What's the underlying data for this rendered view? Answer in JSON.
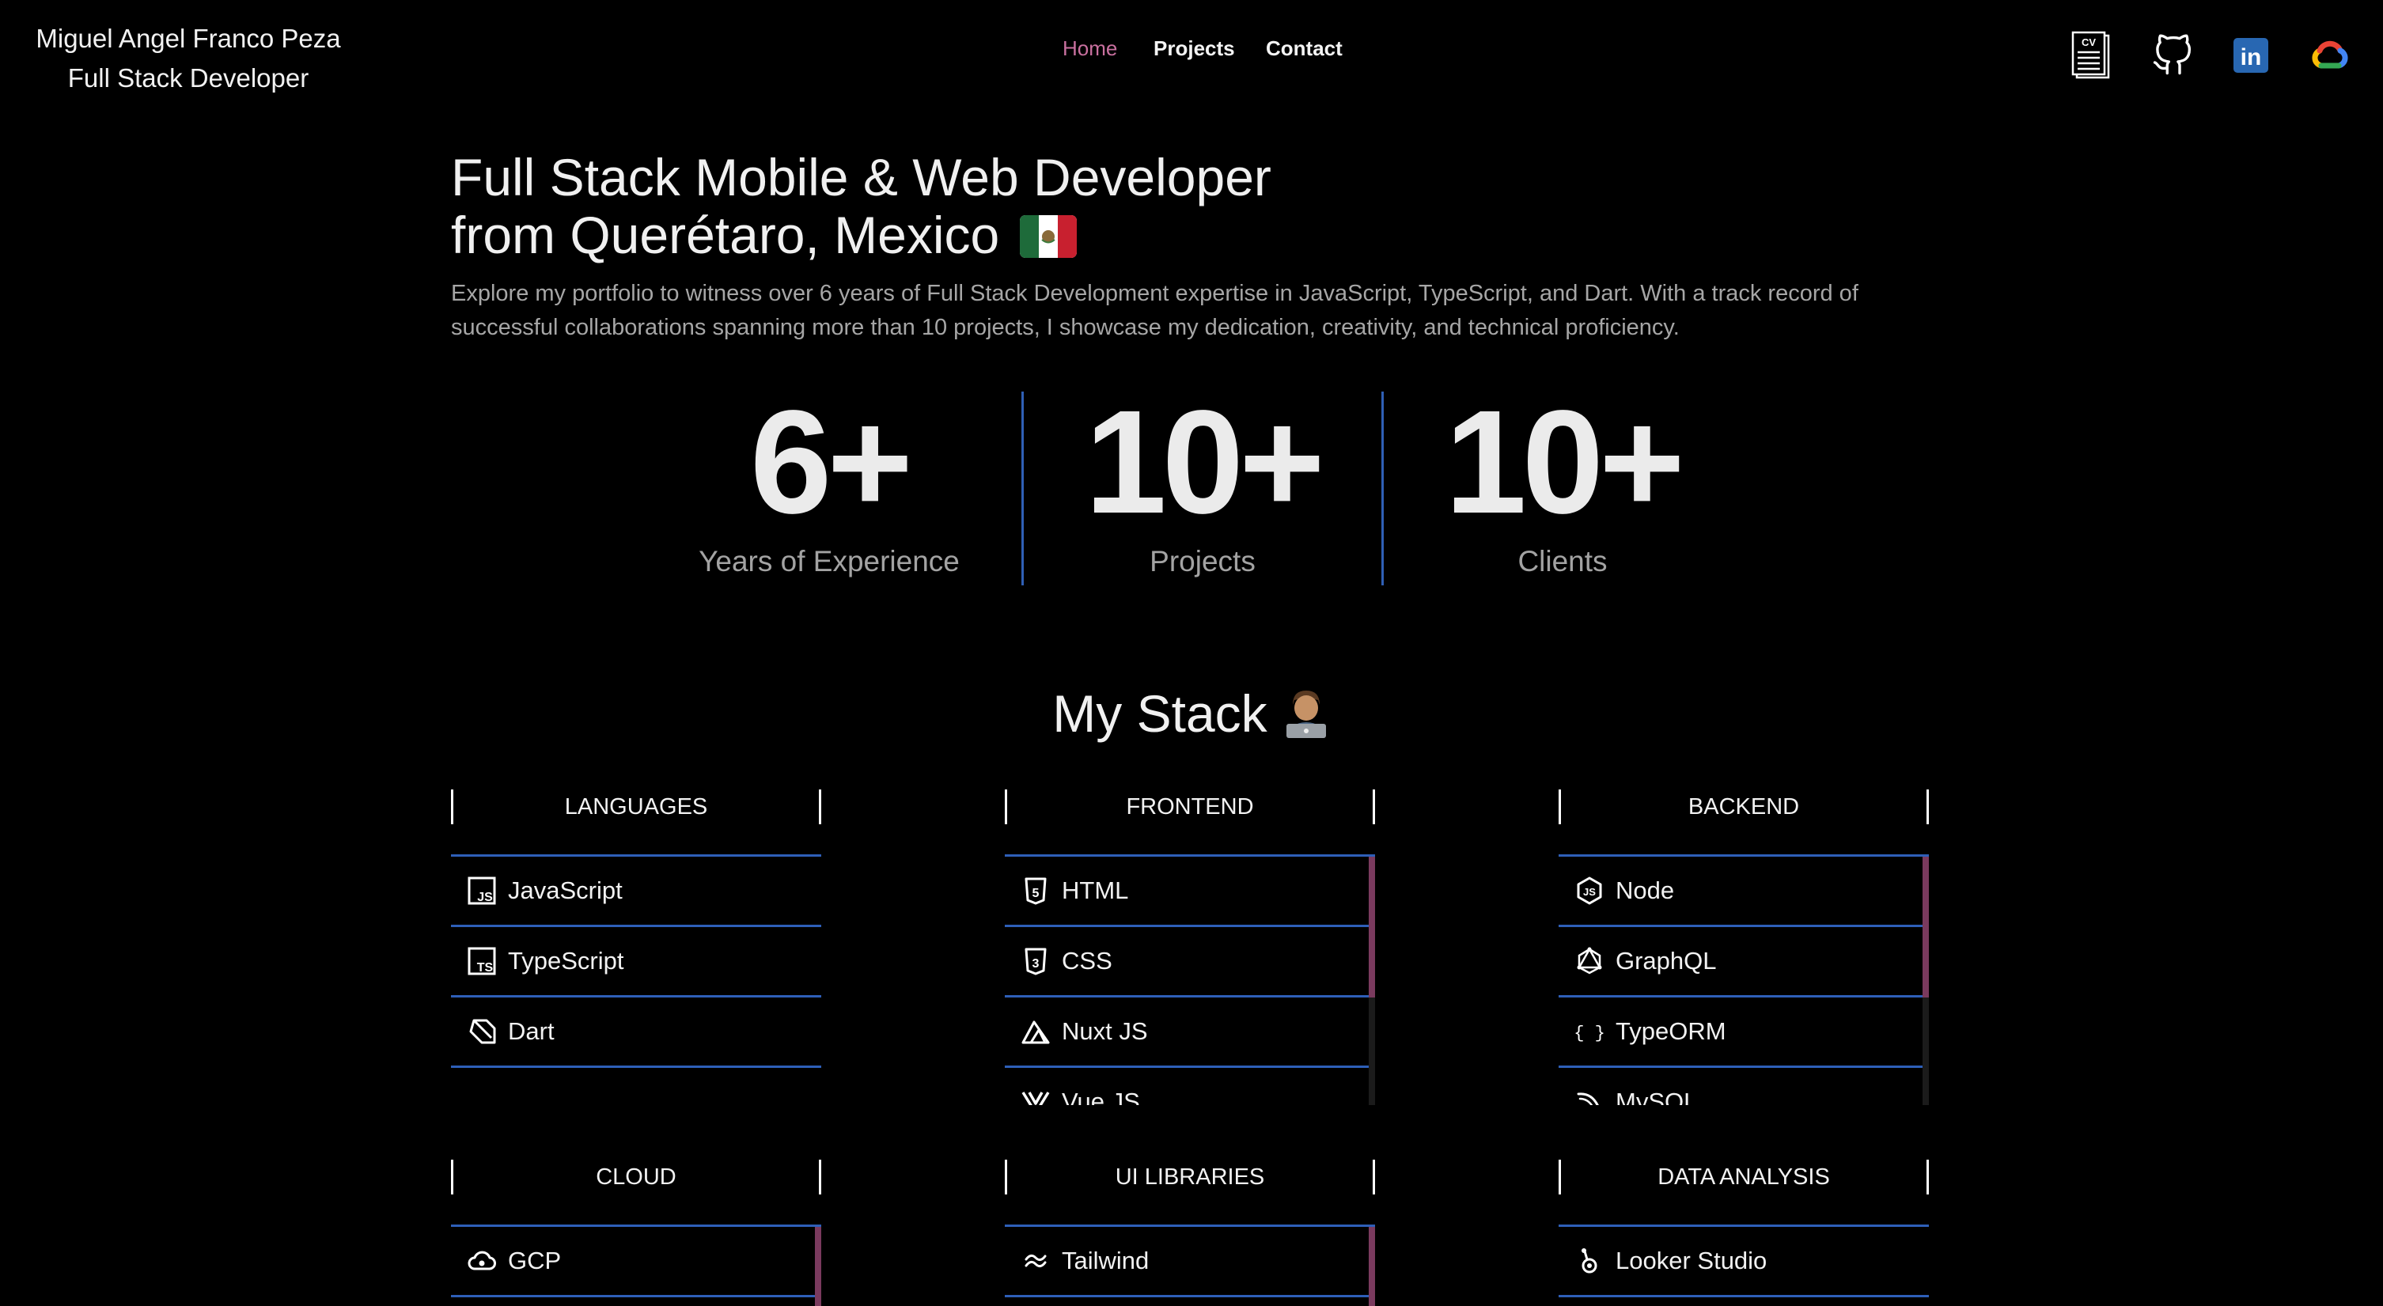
{
  "header": {
    "name": "Miguel Angel Franco Peza",
    "role": "Full Stack Developer",
    "nav": [
      {
        "label": "Home",
        "active": true
      },
      {
        "label": "Projects",
        "active": false
      },
      {
        "label": "Contact",
        "active": false
      }
    ],
    "social_icons": [
      "cv-document-icon",
      "github-icon",
      "linkedin-icon",
      "google-cloud-icon"
    ],
    "cv_icon_text": "CV",
    "linkedin_icon_text": "in",
    "colors": {
      "active_nav": "#c9709f",
      "linkedin": "#2867b2",
      "divider": "#2f5fb5"
    }
  },
  "hero": {
    "title_line1": "Full Stack Mobile & Web Developer",
    "title_line2": "from Querétaro, Mexico",
    "flag_icon": "mexico-flag-icon",
    "description": "Explore my portfolio to witness over 6 years of Full Stack Development expertise in JavaScript, TypeScript, and Dart. With a track record of successful collaborations spanning more than 10 projects, I showcase my dedication, creativity, and technical proficiency."
  },
  "stats": [
    {
      "value": "6+",
      "label": "Years of Experience"
    },
    {
      "value": "10+",
      "label": "Projects"
    },
    {
      "value": "10+",
      "label": "Clients"
    }
  ],
  "stack": {
    "title": "My Stack",
    "title_emoji": "technologist-emoji-icon",
    "categories": [
      {
        "name": "LANGUAGES",
        "items": [
          {
            "label": "JavaScript",
            "icon": "javascript-icon",
            "icon_text": "JS"
          },
          {
            "label": "TypeScript",
            "icon": "typescript-icon",
            "icon_text": "TS"
          },
          {
            "label": "Dart",
            "icon": "dart-icon"
          }
        ]
      },
      {
        "name": "FRONTEND",
        "items": [
          {
            "label": "HTML",
            "icon": "html5-icon",
            "icon_text": "5"
          },
          {
            "label": "CSS",
            "icon": "css3-icon",
            "icon_text": "3"
          },
          {
            "label": "Nuxt JS",
            "icon": "nuxt-icon"
          },
          {
            "label": "Vue JS",
            "icon": "vue-icon"
          }
        ]
      },
      {
        "name": "BACKEND",
        "items": [
          {
            "label": "Node",
            "icon": "nodejs-icon",
            "icon_text": "JS"
          },
          {
            "label": "GraphQL",
            "icon": "graphql-icon"
          },
          {
            "label": "TypeORM",
            "icon": "typeorm-icon",
            "icon_text": "{ }"
          },
          {
            "label": "MySQL",
            "icon": "mysql-icon"
          }
        ]
      },
      {
        "name": "CLOUD",
        "items": [
          {
            "label": "GCP",
            "icon": "gcp-icon"
          }
        ]
      },
      {
        "name": "UI LIBRARIES",
        "items": [
          {
            "label": "Tailwind",
            "icon": "tailwind-icon"
          }
        ]
      },
      {
        "name": "DATA ANALYSIS",
        "items": [
          {
            "label": "Looker Studio",
            "icon": "looker-studio-icon"
          }
        ]
      }
    ]
  }
}
